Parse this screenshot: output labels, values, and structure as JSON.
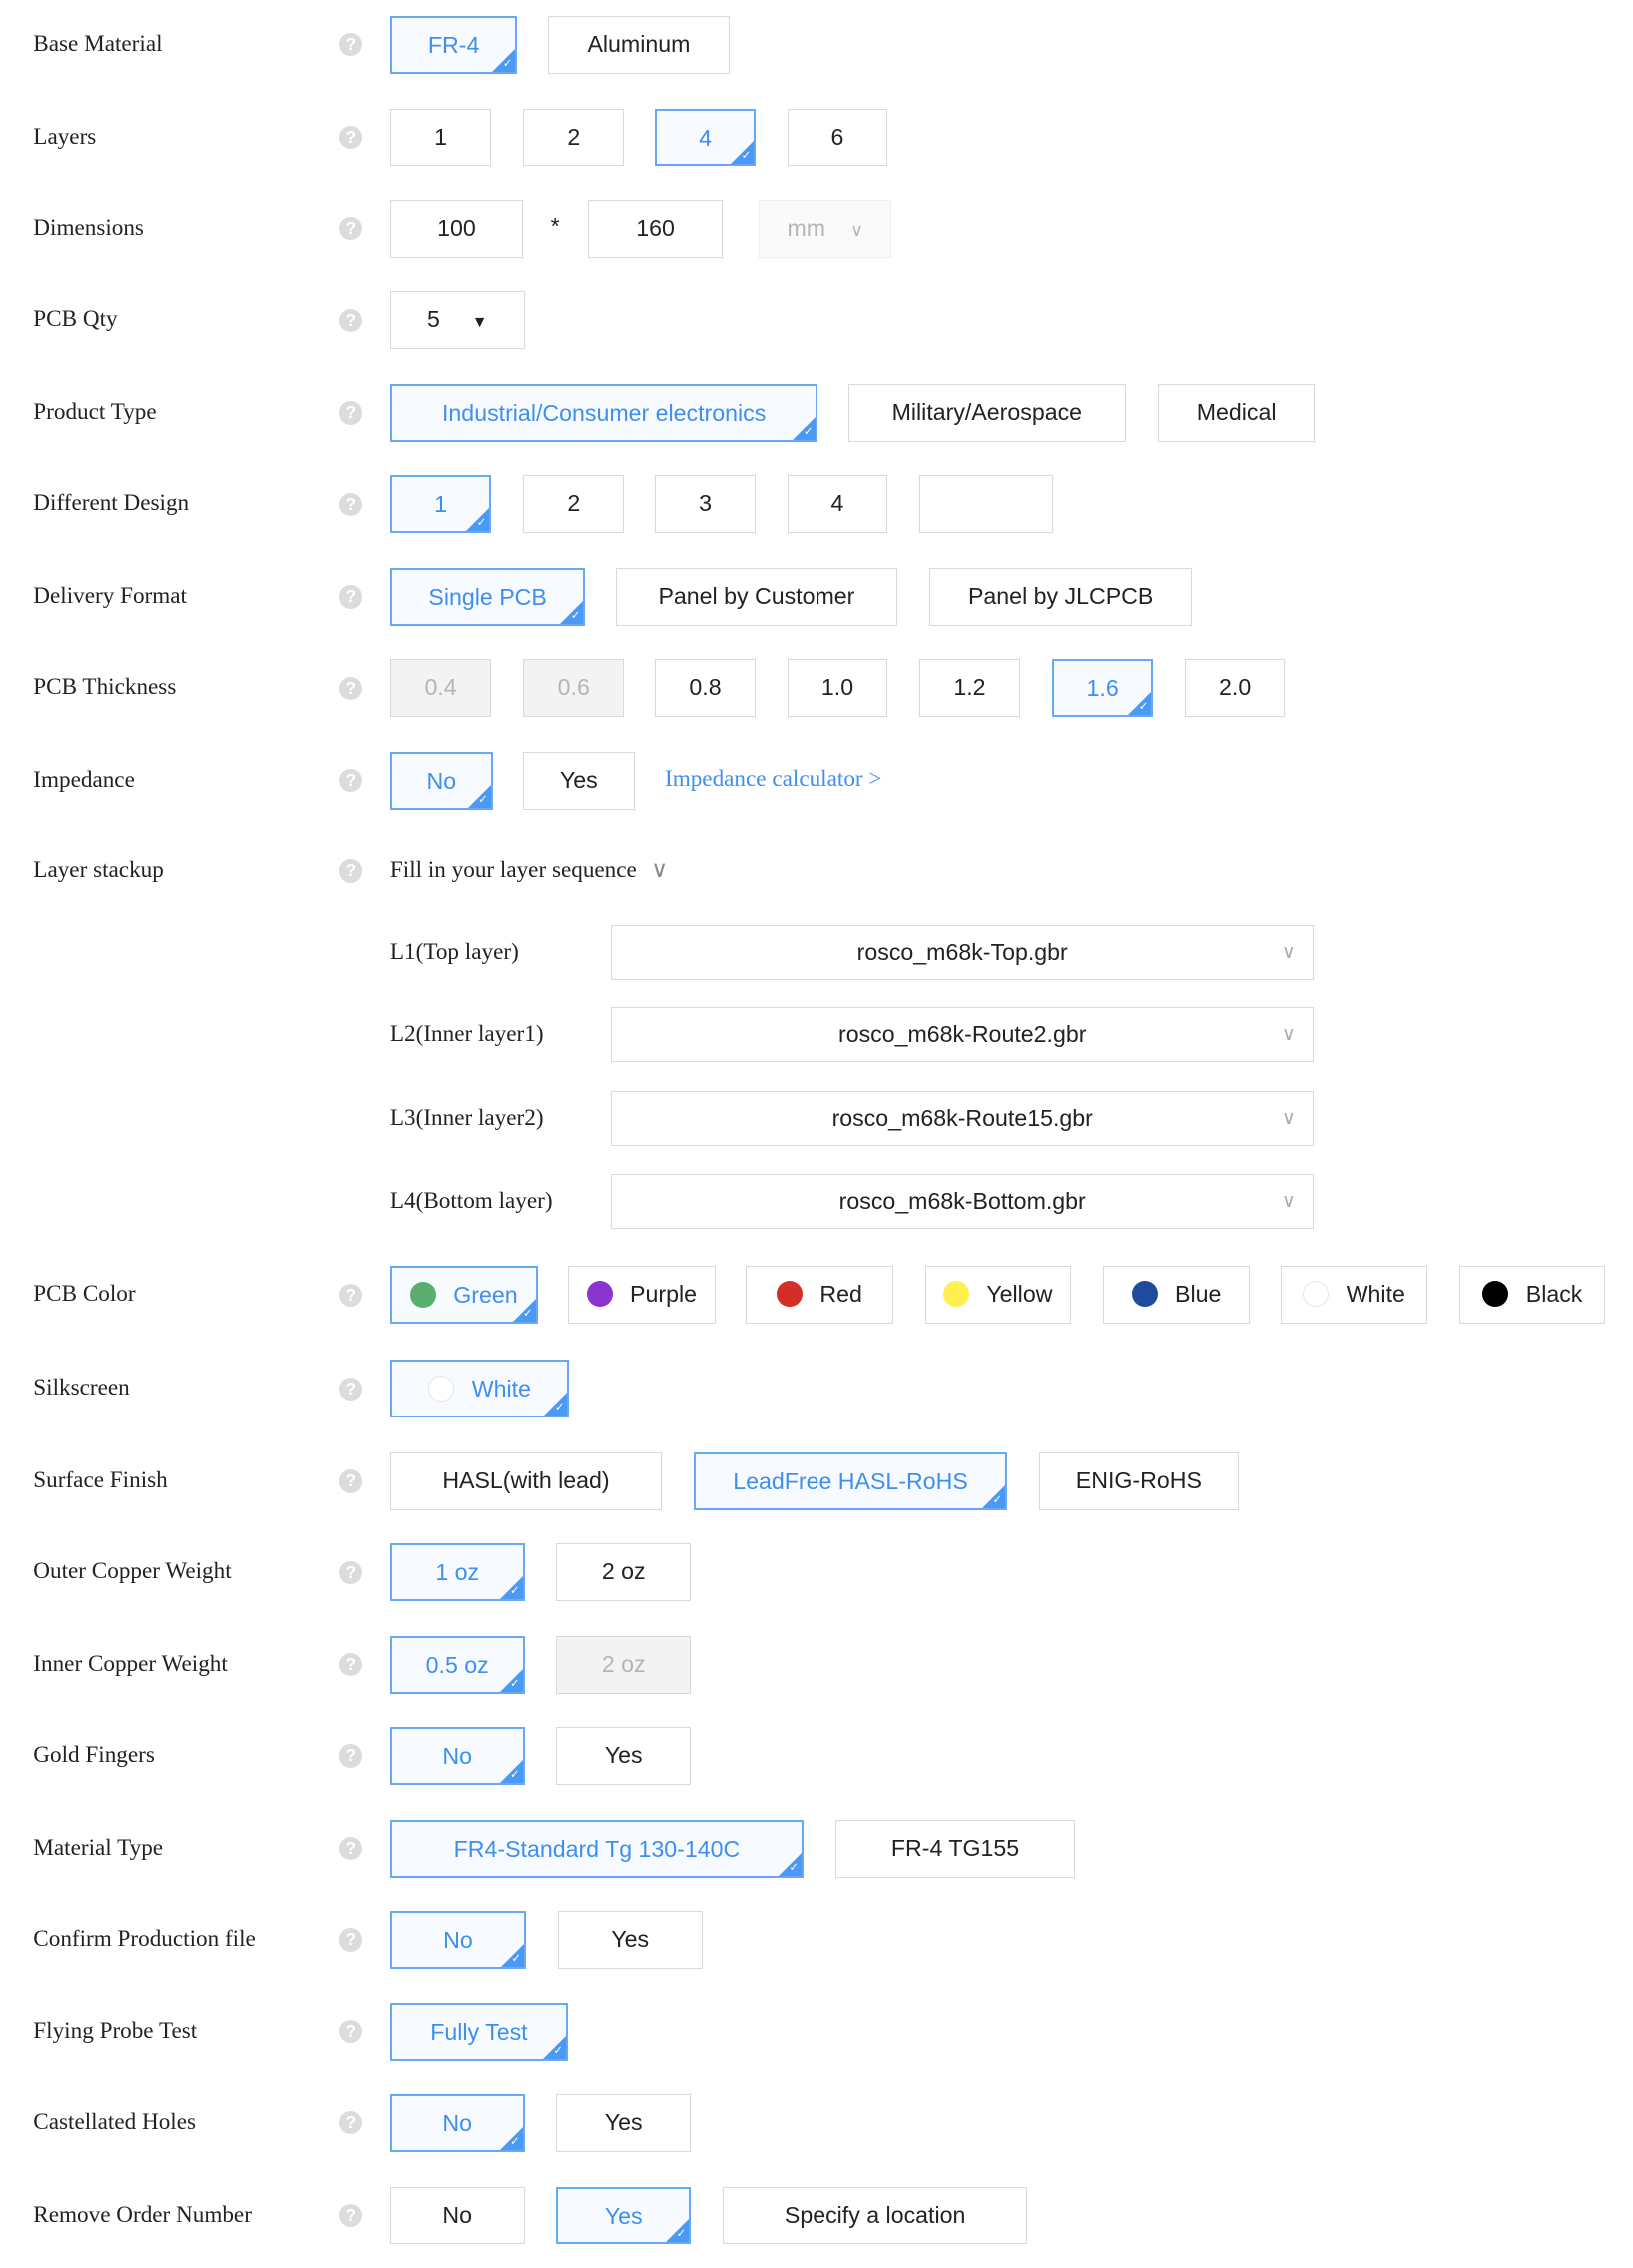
{
  "colors": {
    "accent": "#3d8ff0",
    "accent_border": "#66aaf7",
    "disabled_bg": "#f3f3f3"
  },
  "help_icon": "?",
  "rows": [
    {
      "label": "Base Material",
      "options": [
        {
          "label": "FR-4",
          "selected": true
        },
        {
          "label": "Aluminum"
        }
      ]
    },
    {
      "label": "Layers",
      "options": [
        {
          "label": "1"
        },
        {
          "label": "2"
        },
        {
          "label": "4",
          "selected": true
        },
        {
          "label": "6"
        }
      ]
    },
    {
      "label": "Dimensions",
      "type": "dimensions",
      "width_value": "100",
      "separator": "*",
      "height_value": "160",
      "unit": "mm"
    },
    {
      "label": "PCB Qty",
      "type": "qty",
      "value": "5"
    },
    {
      "label": "Product Type",
      "options": [
        {
          "label": "Industrial/Consumer electronics",
          "selected": true
        },
        {
          "label": "Military/Aerospace"
        },
        {
          "label": "Medical"
        }
      ]
    },
    {
      "label": "Different Design",
      "options": [
        {
          "label": "1",
          "selected": true
        },
        {
          "label": "2"
        },
        {
          "label": "3"
        },
        {
          "label": "4"
        },
        {
          "label": ""
        }
      ]
    },
    {
      "label": "Delivery Format",
      "options": [
        {
          "label": "Single PCB",
          "selected": true
        },
        {
          "label": "Panel by Customer"
        },
        {
          "label": "Panel by JLCPCB"
        }
      ]
    },
    {
      "label": "PCB Thickness",
      "options": [
        {
          "label": "0.4",
          "disabled": true
        },
        {
          "label": "0.6",
          "disabled": true
        },
        {
          "label": "0.8"
        },
        {
          "label": "1.0"
        },
        {
          "label": "1.2"
        },
        {
          "label": "1.6",
          "selected": true
        },
        {
          "label": "2.0"
        }
      ]
    },
    {
      "label": "Impedance",
      "options": [
        {
          "label": "No",
          "selected": true
        },
        {
          "label": "Yes"
        }
      ],
      "link": "Impedance calculator >"
    },
    {
      "label": "Layer stackup",
      "type": "stackup",
      "text": "Fill in your layer sequence"
    },
    {
      "type": "layer",
      "label": "L1(Top layer)",
      "value": "rosco_m68k-Top.gbr"
    },
    {
      "type": "layer",
      "label": "L2(Inner layer1)",
      "value": "rosco_m68k-Route2.gbr"
    },
    {
      "type": "layer",
      "label": "L3(Inner layer2)",
      "value": "rosco_m68k-Route15.gbr"
    },
    {
      "type": "layer",
      "label": "L4(Bottom layer)",
      "value": "rosco_m68k-Bottom.gbr"
    },
    {
      "label": "PCB Color",
      "options": [
        {
          "label": "Green",
          "selected": true,
          "color": "#5aae6e"
        },
        {
          "label": "Purple",
          "color": "#8b35d0"
        },
        {
          "label": "Red",
          "color": "#d42f27"
        },
        {
          "label": "Yellow",
          "color": "#fff04f"
        },
        {
          "label": "Blue",
          "color": "#1f4b9c"
        },
        {
          "label": "White",
          "color": "#ffffff"
        },
        {
          "label": "Black",
          "color": "#000000"
        }
      ]
    },
    {
      "label": "Silkscreen",
      "options": [
        {
          "label": "White",
          "selected": true,
          "color": "#ffffff"
        }
      ]
    },
    {
      "label": "Surface Finish",
      "options": [
        {
          "label": "HASL(with lead)"
        },
        {
          "label": "LeadFree HASL-RoHS",
          "selected": true
        },
        {
          "label": "ENIG-RoHS"
        }
      ]
    },
    {
      "label": "Outer Copper Weight",
      "options": [
        {
          "label": "1 oz",
          "selected": true
        },
        {
          "label": "2 oz"
        }
      ]
    },
    {
      "label": "Inner Copper Weight",
      "options": [
        {
          "label": "0.5 oz",
          "selected": true
        },
        {
          "label": "2 oz",
          "disabled": true
        }
      ]
    },
    {
      "label": "Gold Fingers",
      "options": [
        {
          "label": "No",
          "selected": true
        },
        {
          "label": "Yes"
        }
      ]
    },
    {
      "label": "Material Type",
      "options": [
        {
          "label": "FR4-Standard Tg 130-140C",
          "selected": true
        },
        {
          "label": "FR-4 TG155"
        }
      ]
    },
    {
      "label": "Confirm Production file",
      "options": [
        {
          "label": "No",
          "selected": true
        },
        {
          "label": "Yes"
        }
      ]
    },
    {
      "label": "Flying Probe Test",
      "options": [
        {
          "label": "Fully Test",
          "selected": true
        }
      ]
    },
    {
      "label": "Castellated Holes",
      "options": [
        {
          "label": "No",
          "selected": true
        },
        {
          "label": "Yes"
        }
      ]
    },
    {
      "label": "Remove Order Number",
      "options": [
        {
          "label": "No"
        },
        {
          "label": "Yes",
          "selected": true
        },
        {
          "label": "Specify a location"
        }
      ]
    }
  ]
}
